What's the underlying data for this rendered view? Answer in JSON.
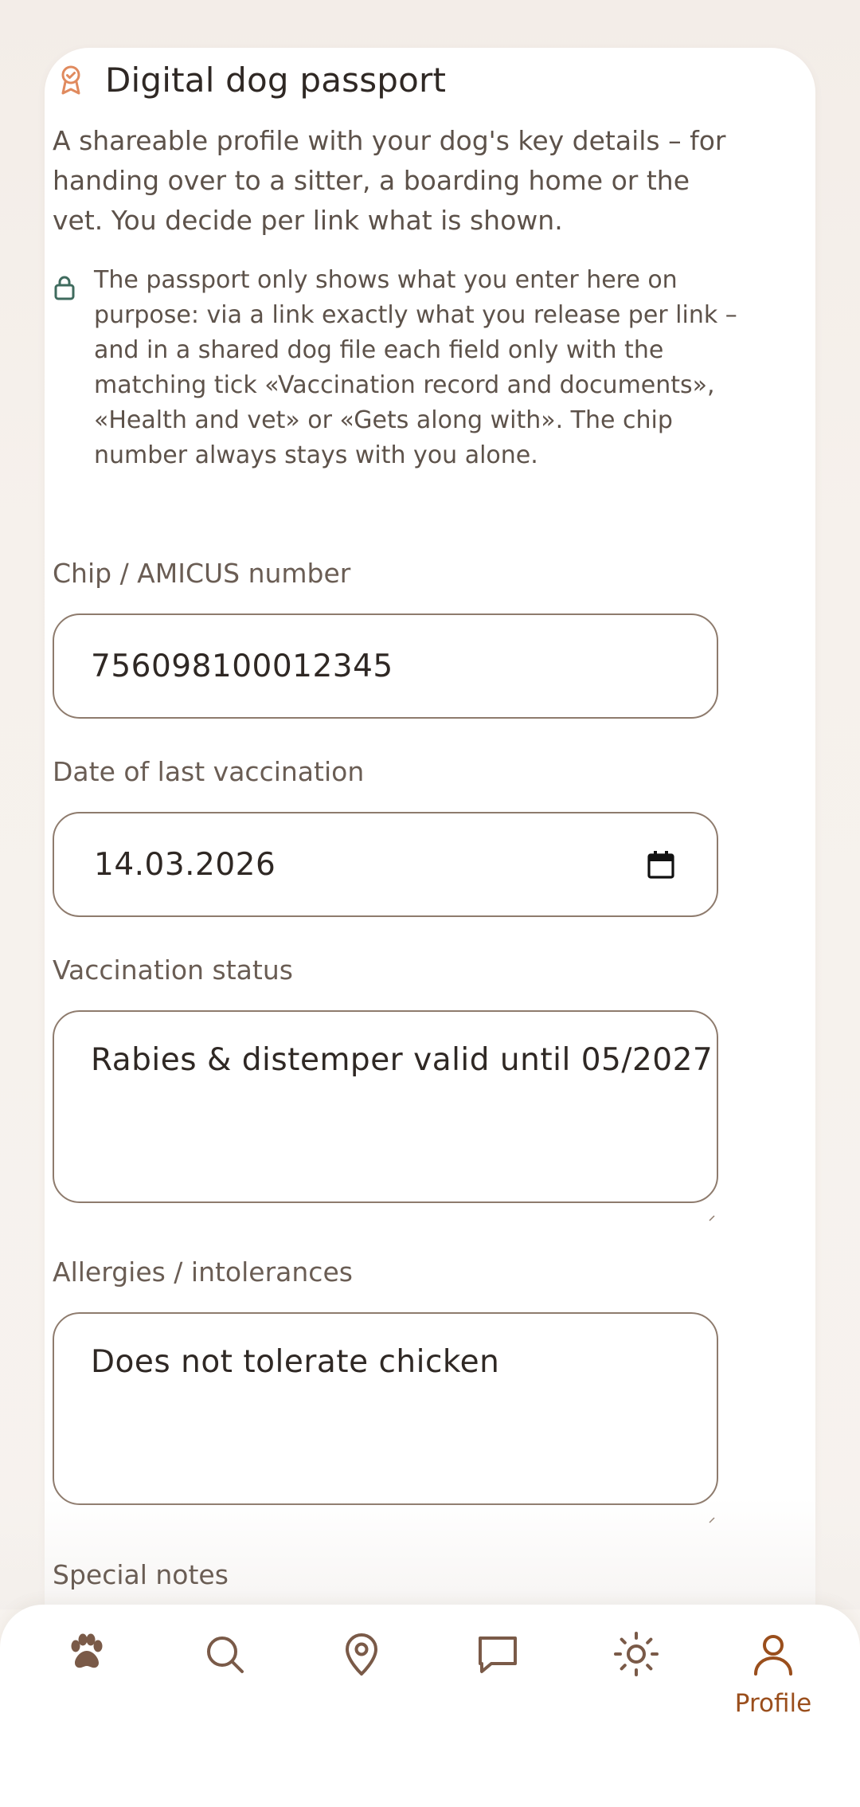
{
  "passport": {
    "title": "Digital dog passport",
    "title_icon": "award-ribbon-icon",
    "intro": "A shareable profile with your dog's key details – for handing over to a sitter, a boarding home or the vet. You decide per link what is shown.",
    "privacy_icon": "lock-icon",
    "privacy_note": "The passport only shows what you enter here on purpose: via a link exactly what you release per link – and in a shared dog file each field only with the matching tick «Vaccination record and documents», «Health and vet» or «Gets along with». The chip number always stays with you alone."
  },
  "fields": {
    "chip": {
      "label": "Chip / AMICUS number",
      "value": "756098100012345"
    },
    "vaccination_date": {
      "label": "Date of last vaccination",
      "value": "14.03.2026",
      "icon": "calendar-icon"
    },
    "vaccination_status": {
      "label": "Vaccination status",
      "value": "Rabies & distemper valid until 05/2027"
    },
    "allergies": {
      "label": "Allergies / intolerances",
      "value": "Does not tolerate chicken"
    },
    "special_notes": {
      "label": "Special notes"
    }
  },
  "bottom_nav": {
    "items": [
      {
        "icon": "paw-icon",
        "active": false
      },
      {
        "icon": "search-icon",
        "active": false
      },
      {
        "icon": "map-pin-icon",
        "active": false
      },
      {
        "icon": "chat-icon",
        "active": false
      },
      {
        "icon": "sun-icon",
        "active": false
      },
      {
        "icon": "user-icon",
        "active": true,
        "label": "Profile"
      }
    ]
  },
  "colors": {
    "accent": "#9a4e1c",
    "icon_orange": "#e08a5e",
    "lock_green": "#3f6b5e",
    "field_border": "#8e7b6d",
    "nav_icon": "#7a5a48"
  }
}
